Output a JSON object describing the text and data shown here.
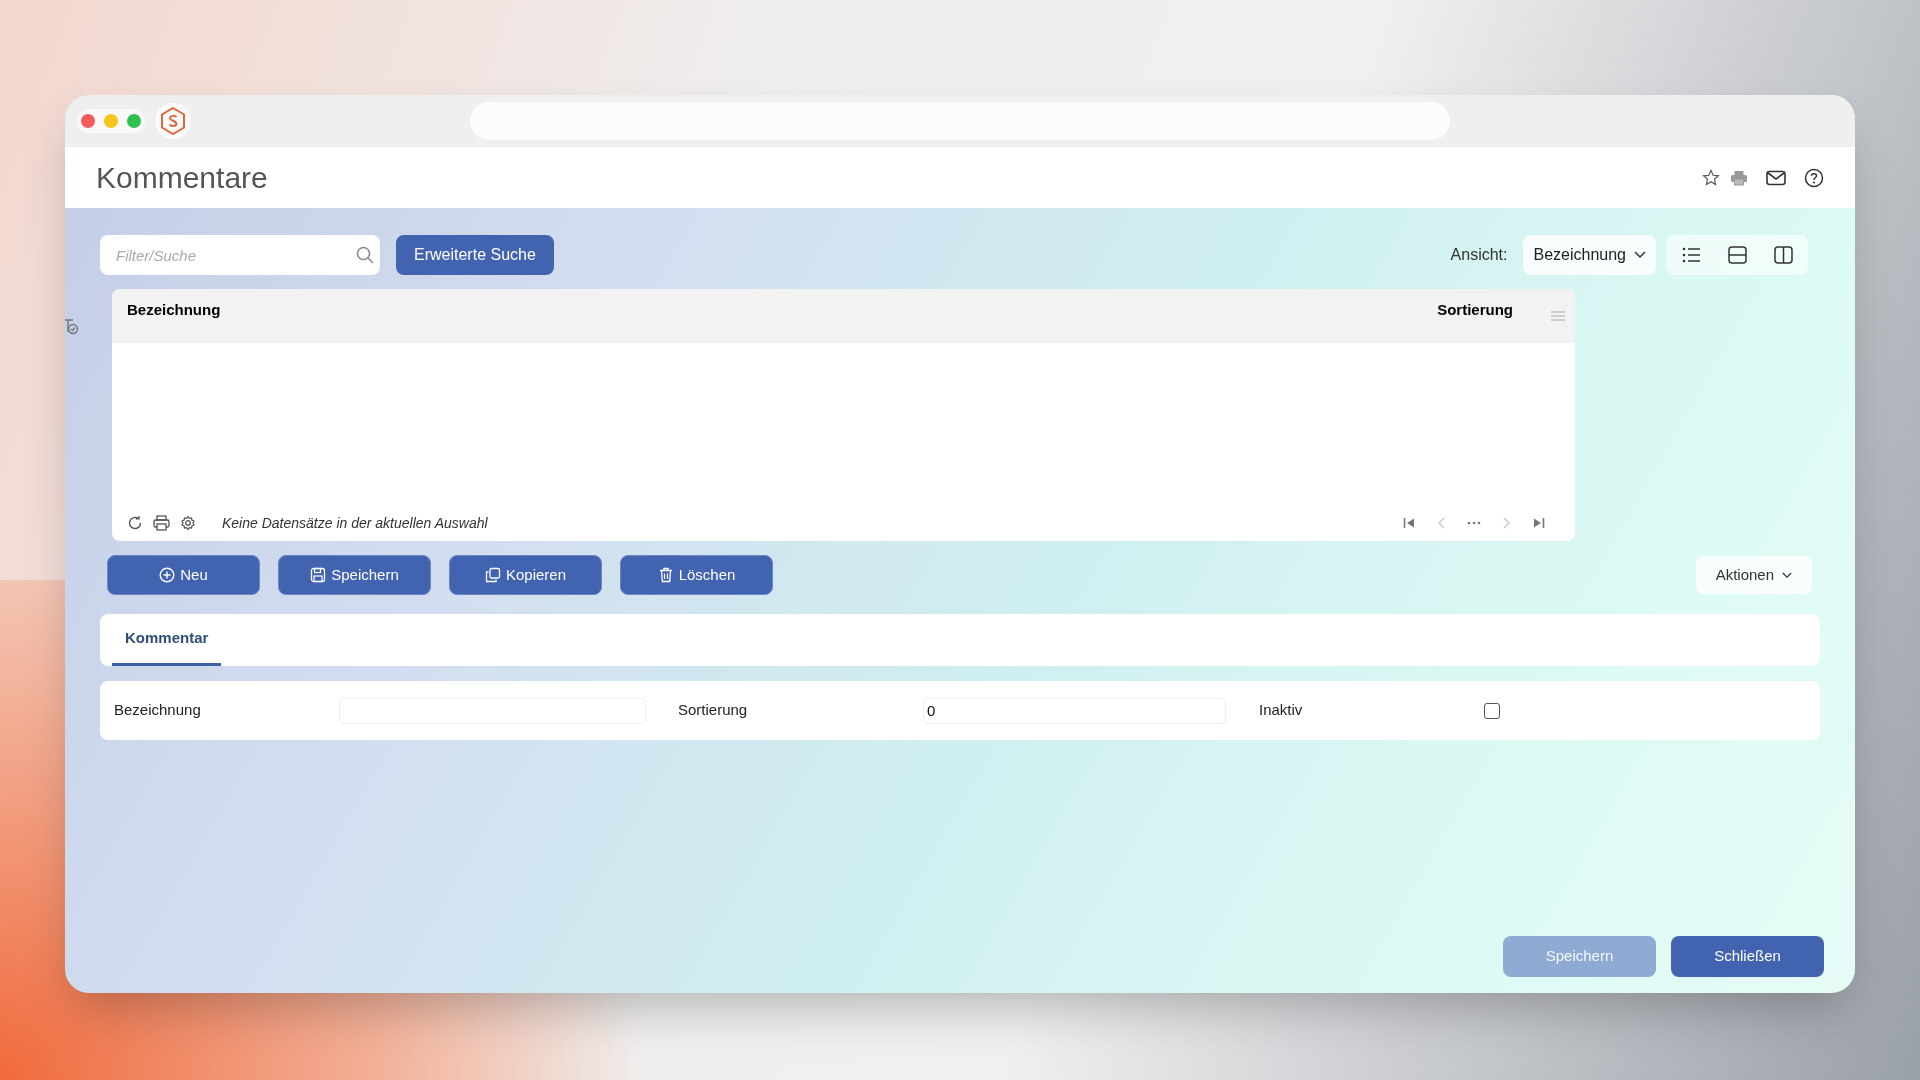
{
  "window": {
    "title": "Kommentare"
  },
  "header_icons": [
    {
      "kind": "star"
    },
    {
      "kind": "print"
    },
    {
      "kind": "mail"
    },
    {
      "kind": "help"
    }
  ],
  "toolbar": {
    "search": {
      "placeholder": "Filter/Suche"
    },
    "advanced_search": "Erweiterte Suche",
    "view_label": "Ansicht:",
    "view_value": "Bezeichnung",
    "view_modes": [
      {
        "kind": "list",
        "selected": false
      },
      {
        "kind": "rows",
        "selected": false
      },
      {
        "kind": "columns",
        "selected": false
      }
    ]
  },
  "table": {
    "columns": [
      "Bezeichnung",
      "Sortierung"
    ],
    "empty_message": "Keine Datensätze in der aktuellen Auswahl"
  },
  "actions": [
    {
      "kind": "new",
      "label": "Neu"
    },
    {
      "kind": "save",
      "label": "Speichern"
    },
    {
      "kind": "copy",
      "label": "Kopieren"
    },
    {
      "kind": "delete",
      "label": "Löschen"
    }
  ],
  "actions_menu": "Aktionen",
  "tabs": [
    {
      "label": "Kommentar",
      "selected": true
    }
  ],
  "form": {
    "fields": [
      {
        "kind": "text",
        "label": "Bezeichnung"
      },
      {
        "kind": "text",
        "label": "Sortierung",
        "value": "0"
      },
      {
        "kind": "checkbox",
        "label": "Inaktiv",
        "checked": false
      }
    ]
  },
  "footer_buttons": [
    {
      "label": "Speichern",
      "disabled": true
    },
    {
      "label": "Schließen",
      "disabled": false
    }
  ]
}
